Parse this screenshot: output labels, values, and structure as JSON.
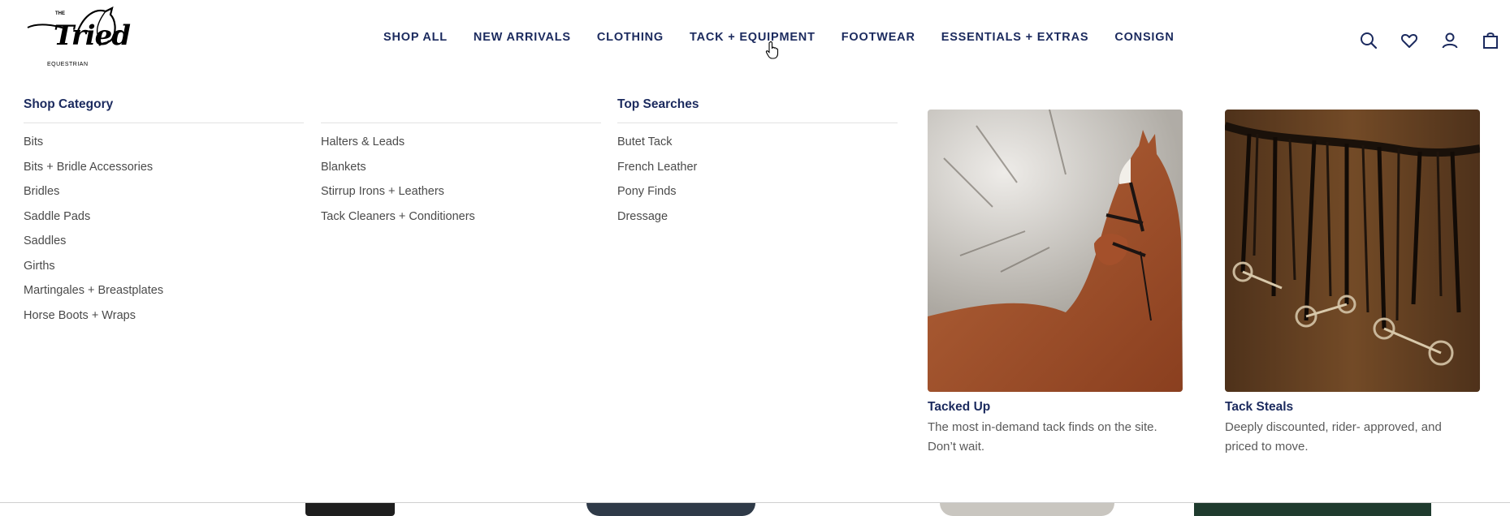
{
  "brand": {
    "the": "THE",
    "name": "Tried",
    "sub": "EQUESTRIAN"
  },
  "nav": {
    "items": [
      "SHOP ALL",
      "NEW ARRIVALS",
      "CLOTHING",
      "TACK + EQUIPMENT",
      "FOOTWEAR",
      "ESSENTIALS + EXTRAS",
      "CONSIGN"
    ]
  },
  "header_icons": [
    "search-icon",
    "heart-icon",
    "account-icon",
    "bag-icon"
  ],
  "menu": {
    "shop_category": {
      "heading": "Shop Category",
      "col1": [
        "Bits",
        "Bits + Bridle Accessories",
        "Bridles",
        "Saddle Pads",
        "Saddles",
        "Girths",
        "Martingales + Breastplates",
        "Horse Boots + Wraps"
      ],
      "col2": [
        "Halters & Leads",
        "Blankets",
        "Stirrup Irons + Leathers",
        "Tack Cleaners + Conditioners"
      ]
    },
    "top_searches": {
      "heading": "Top Searches",
      "items": [
        "Butet Tack",
        "French Leather",
        "Pony Finds",
        "Dressage"
      ]
    },
    "promos": [
      {
        "title": "Tacked Up",
        "desc_line1": "The most in-demand tack finds on the site.",
        "desc_line2": "Don’t wait."
      },
      {
        "title": "Tack Steals",
        "desc_line1": "Deeply discounted, rider- approved, and",
        "desc_line2": "priced to move."
      }
    ]
  },
  "colors": {
    "brand_navy": "#1b2a5e",
    "link_gray": "#4a4a4a",
    "desc_gray": "#5a5a5a"
  }
}
